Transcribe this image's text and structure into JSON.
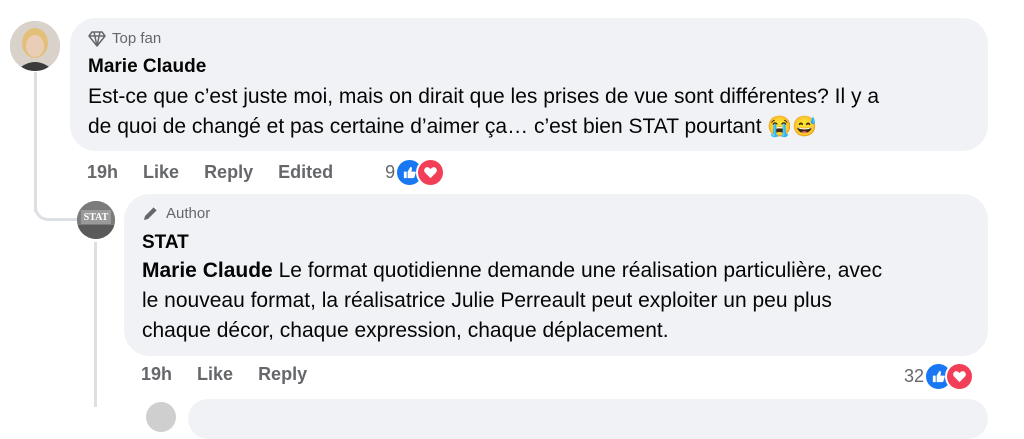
{
  "comment1": {
    "badge": "Top fan",
    "author": "Marie Claude",
    "text_line1": "Est-ce que c’est juste moi, mais on dirait que les prises de vue sont différentes? Il y a",
    "text_line2": "de quoi de changé et pas certaine d’aimer ça… c’est bien STAT pourtant",
    "emojis": "😭😅",
    "time": "19h",
    "like_label": "Like",
    "reply_label": "Reply",
    "edited_label": "Edited",
    "reaction_count": "9"
  },
  "reply1": {
    "badge": "Author",
    "author": "STAT",
    "avatar_text": "STAT",
    "mention": "Marie Claude",
    "text_line1": "Le format quotidienne demande une réalisation particulière, avec",
    "text_line2": "le nouveau format, la réalisatrice Julie Perreault peut exploiter un peu plus",
    "text_line3": "chaque décor, chaque expression, chaque déplacement.",
    "time": "19h",
    "like_label": "Like",
    "reply_label": "Reply",
    "reaction_count": "32"
  },
  "colors": {
    "like": "#1877f2",
    "love": "#f33e58",
    "bubble": "#f0f2f5",
    "meta": "#65676b"
  }
}
